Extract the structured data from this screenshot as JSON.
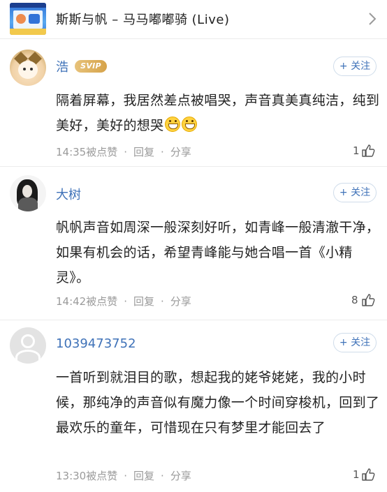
{
  "song_bar": {
    "title": "斯斯与帆 – 马马嘟嘟骑 (Live)",
    "cover_icon": "album-cover",
    "chevron_icon": "chevron-right-icon"
  },
  "comments": [
    {
      "username": "浩",
      "badge": "SVIP",
      "follow_label": "+ 关注",
      "content": "隔着屏幕，我居然差点被唱哭，声音真美真纯洁，纯到美好，美好的想哭",
      "emoji_count": 2,
      "time": "14:35",
      "like_action": "被点赞",
      "reply_label": "回复",
      "share_label": "分享",
      "sep": "·",
      "likes": "1"
    },
    {
      "username": "大树",
      "follow_label": "+ 关注",
      "content": "帆帆声音如周深一般深刻好听，如青峰一般清澈干净，如果有机会的话，希望青峰能与她合唱一首《小精灵》。",
      "time": "14:42",
      "like_action": "被点赞",
      "reply_label": "回复",
      "share_label": "分享",
      "sep": "·",
      "likes": "8"
    },
    {
      "username": "1039473752",
      "follow_label": "+ 关注",
      "content": "一首听到就泪目的歌，想起我的姥爷姥姥，我的小时候，那纯净的声音似有魔力像一个时间穿梭机，回到了最欢乐的童年，可惜现在只有梦里才能回去了",
      "time": "13:30",
      "like_action": "被点赞",
      "reply_label": "回复",
      "share_label": "分享",
      "sep": "·",
      "likes": "1"
    }
  ],
  "colors": {
    "username": "#3f72b8",
    "svip_gold": "#d6a34a",
    "follow_text": "#3f72b8",
    "meta_gray": "#9a9a9a"
  }
}
